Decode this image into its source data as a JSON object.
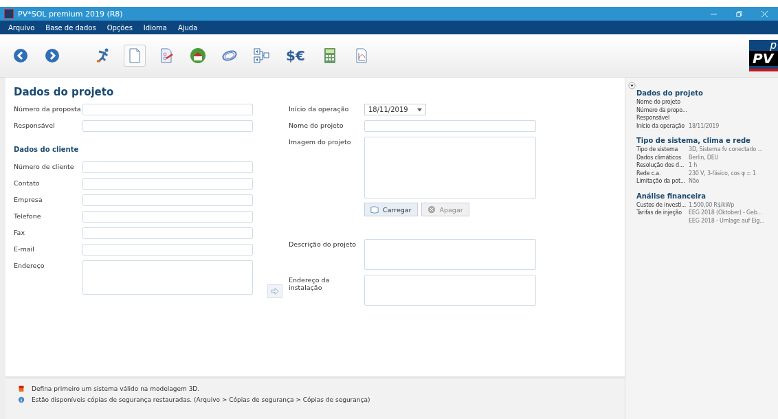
{
  "window": {
    "title": "PV*SOL premium 2019 (R8)"
  },
  "menu": [
    "Arquivo",
    "Base de dados",
    "Opções",
    "Idioma",
    "Ajuda"
  ],
  "toolbar": [
    {
      "kind": "back",
      "selected": false
    },
    {
      "kind": "forward",
      "selected": false
    },
    {
      "kind": "runner",
      "selected": false
    },
    {
      "kind": "page",
      "selected": true
    },
    {
      "kind": "report",
      "selected": false
    },
    {
      "kind": "house",
      "selected": false
    },
    {
      "kind": "ring",
      "selected": false
    },
    {
      "kind": "diagram",
      "selected": false
    },
    {
      "kind": "currency",
      "label": "$€",
      "selected": false
    },
    {
      "kind": "calculator",
      "selected": false
    },
    {
      "kind": "chart",
      "selected": false
    }
  ],
  "logo": {
    "top": "p",
    "main": "PV"
  },
  "page_title": "Dados do projeto",
  "left_fields": [
    {
      "label": "Número da proposta",
      "kind": "text"
    },
    {
      "label": "Responsável",
      "kind": "text"
    }
  ],
  "client_heading": "Dados do cliente",
  "client_fields": [
    {
      "label": "Número de cliente",
      "kind": "text"
    },
    {
      "label": "Contato",
      "kind": "text"
    },
    {
      "label": "Empresa",
      "kind": "text"
    },
    {
      "label": "Telefone",
      "kind": "text"
    },
    {
      "label": "Fax",
      "kind": "text"
    },
    {
      "label": "E-mail",
      "kind": "text"
    },
    {
      "label": "Endereço",
      "kind": "area"
    }
  ],
  "right_fields": [
    {
      "label": "Início da operação",
      "kind": "date",
      "value": "18/11/2019"
    },
    {
      "label": "Nome do projeto",
      "kind": "text"
    },
    {
      "label": "Imagem do projeto",
      "kind": "image"
    },
    {
      "label": "Descrição do projeto",
      "kind": "area"
    },
    {
      "label": "Endereço da instalação",
      "kind": "area"
    }
  ],
  "image_buttons": [
    {
      "label": "Carregar",
      "disabled": false
    },
    {
      "label": "Apagar",
      "disabled": true
    }
  ],
  "summary": [
    {
      "title": "Dados do projeto",
      "rows": [
        {
          "label": "Nome do projeto"
        },
        {
          "label": "Número da propo..."
        },
        {
          "label": "Responsável"
        },
        {
          "label": "Início da operação",
          "value": "18/11/2019"
        }
      ]
    },
    {
      "title": "Tipo de sistema, clima e rede",
      "rows": [
        {
          "label": "Tipo de sistema",
          "value": "3D, Sistema fv conectado ..."
        },
        {
          "label": "Dados climáticos",
          "value": "Berlin, DEU"
        },
        {
          "label": "Resolução dos d...",
          "value": "1 h"
        },
        {
          "label": "Rede c.a.",
          "value": "230 V, 3-fásico, cos φ = 1"
        },
        {
          "label": "Limitação da pot...",
          "value": "Não"
        }
      ]
    },
    {
      "title": "Análise financeira",
      "rows": [
        {
          "label": "Custos de investi...",
          "value": "1.500,00 R$/kWp"
        },
        {
          "label": "Tarifas de injeção",
          "value": "EEG 2018 (Oktober) - Geb..."
        },
        {
          "value": "EEG 2018 - Umlage auf Eig..."
        }
      ]
    }
  ],
  "messages": [
    {
      "kind": "warning",
      "text": "Defina primeiro um sistema válido na modelagem 3D."
    },
    {
      "kind": "info",
      "text": "Estão disponíveis cópias de segurança restauradas. (Arquivo > Cópias de segurança > Cópias de segurança)"
    }
  ]
}
